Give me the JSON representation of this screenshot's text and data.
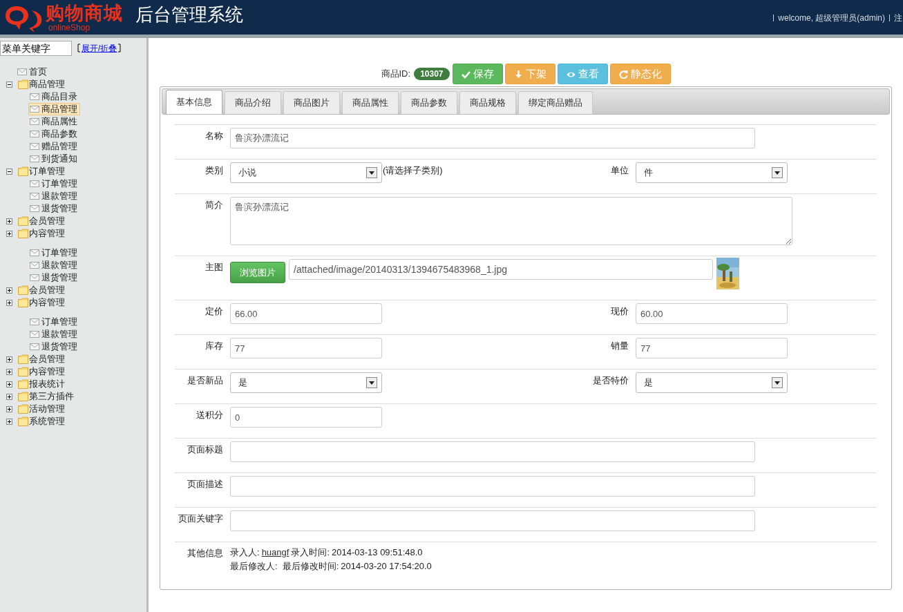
{
  "header": {
    "logo_text": "购物商城",
    "logo_sub": "onlineShop",
    "title": "后台管理系统",
    "user_info": "welcome, 超级管理员(admin)",
    "logout": "注"
  },
  "sidebar": {
    "search": {
      "placeholder": "菜单关键字"
    },
    "toggle_link": "展开/折叠",
    "segments": [
      {
        "nodes": [
          {
            "kind": "page",
            "label": "首页",
            "selected": false
          },
          {
            "kind": "folder",
            "label": "商品管理",
            "expanded": true,
            "selected": false,
            "children": [
              {
                "kind": "page",
                "label": "商品目录",
                "selected": false
              },
              {
                "kind": "page",
                "label": "商品管理",
                "selected": true
              },
              {
                "kind": "page",
                "label": "商品属性",
                "selected": false
              },
              {
                "kind": "page",
                "label": "商品参数",
                "selected": false
              },
              {
                "kind": "page",
                "label": "赠品管理",
                "selected": false
              },
              {
                "kind": "page",
                "label": "到货通知",
                "selected": false
              }
            ]
          },
          {
            "kind": "folder",
            "label": "订单管理",
            "expanded": true,
            "selected": false,
            "children": [
              {
                "kind": "page",
                "label": "订单管理",
                "selected": false
              },
              {
                "kind": "page",
                "label": "退款管理",
                "selected": false
              },
              {
                "kind": "page",
                "label": "退货管理",
                "selected": false
              }
            ]
          },
          {
            "kind": "folder",
            "label": "会员管理",
            "expanded": false,
            "selected": false
          },
          {
            "kind": "folder",
            "label": "内容管理",
            "expanded": false,
            "selected": false
          }
        ]
      },
      {
        "continued": [
          {
            "kind": "page",
            "label": "订单管理",
            "selected": false
          },
          {
            "kind": "page",
            "label": "退款管理",
            "selected": false
          },
          {
            "kind": "page",
            "label": "退货管理",
            "selected": false
          }
        ],
        "nodes": [
          {
            "kind": "folder",
            "label": "会员管理",
            "expanded": false,
            "selected": false
          },
          {
            "kind": "folder",
            "label": "内容管理",
            "expanded": false,
            "selected": false
          }
        ]
      },
      {
        "continued": [
          {
            "kind": "page",
            "label": "订单管理",
            "selected": false
          },
          {
            "kind": "page",
            "label": "退款管理",
            "selected": false
          },
          {
            "kind": "page",
            "label": "退货管理",
            "selected": false
          }
        ],
        "nodes": [
          {
            "kind": "folder",
            "label": "会员管理",
            "expanded": false,
            "selected": false
          },
          {
            "kind": "folder",
            "label": "内容管理",
            "expanded": false,
            "selected": false
          },
          {
            "kind": "folder",
            "label": "报表统计",
            "expanded": false,
            "selected": false
          },
          {
            "kind": "folder",
            "label": "第三方插件",
            "expanded": false,
            "selected": false
          },
          {
            "kind": "folder",
            "label": "活动管理",
            "expanded": false,
            "selected": false
          },
          {
            "kind": "folder",
            "label": "系统管理",
            "expanded": false,
            "selected": false
          }
        ]
      }
    ]
  },
  "toolbar": {
    "id_label": "商品ID:",
    "id_value": "10307",
    "buttons": [
      {
        "kind": "save",
        "label": "保存"
      },
      {
        "kind": "down",
        "label": "下架"
      },
      {
        "kind": "view",
        "label": "查看"
      },
      {
        "kind": "static",
        "label": "静态化"
      }
    ]
  },
  "tabs": [
    {
      "label": "基本信息",
      "selected": true
    },
    {
      "label": "商品介绍",
      "selected": false
    },
    {
      "label": "商品图片",
      "selected": false
    },
    {
      "label": "商品属性",
      "selected": false
    },
    {
      "label": "商品参数",
      "selected": false
    },
    {
      "label": "商品规格",
      "selected": false
    },
    {
      "label": "绑定商品赠品",
      "selected": false
    }
  ],
  "form": [
    {
      "fields": [
        {
          "kind": "text_long",
          "label": "名称",
          "value": "鲁滨孙漂流记"
        }
      ]
    },
    {
      "fields": [
        {
          "kind": "select",
          "label": "类别",
          "value": "小说",
          "note": "(请选择子类别)"
        },
        {
          "kind": "select",
          "label": "单位",
          "value": "件"
        }
      ]
    },
    {
      "fields": [
        {
          "kind": "textarea",
          "label": "简介",
          "value": "鲁滨孙漂流记"
        }
      ]
    },
    {
      "fields": [
        {
          "kind": "file",
          "label": "主图",
          "button": "浏览图片",
          "value": "/attached/image/20140313/1394675483968_1.jpg"
        }
      ]
    },
    {
      "fields": [
        {
          "kind": "text",
          "label": "定价",
          "value": "66.00"
        },
        {
          "kind": "text",
          "label": "现价",
          "value": "60.00"
        }
      ]
    },
    {
      "fields": [
        {
          "kind": "text",
          "label": "库存",
          "value": "77"
        },
        {
          "kind": "text",
          "label": "销量",
          "value": "77"
        }
      ]
    },
    {
      "fields": [
        {
          "kind": "select",
          "label": "是否新品",
          "value": "是"
        },
        {
          "kind": "select",
          "label": "是否特价",
          "value": "是"
        }
      ]
    },
    {
      "fields": [
        {
          "kind": "text",
          "label": "送积分",
          "value": "0"
        }
      ]
    },
    {
      "fields": [
        {
          "kind": "text_long",
          "label": "页面标题"
        }
      ]
    },
    {
      "fields": [
        {
          "kind": "text_long",
          "label": "页面描述"
        }
      ]
    },
    {
      "fields": [
        {
          "kind": "text_long",
          "label": "页面关键字"
        }
      ]
    }
  ],
  "other_info": {
    "label": "其他信息",
    "creator_label": "录入人:",
    "creator": "huangf",
    "created_label": "录入时间:",
    "created": "2014-03-13 09:51:48.0",
    "modifier_label": "最后修改人:",
    "modified_label": "最后修改时间:",
    "modified": "2014-03-20 17:54:20.0"
  }
}
